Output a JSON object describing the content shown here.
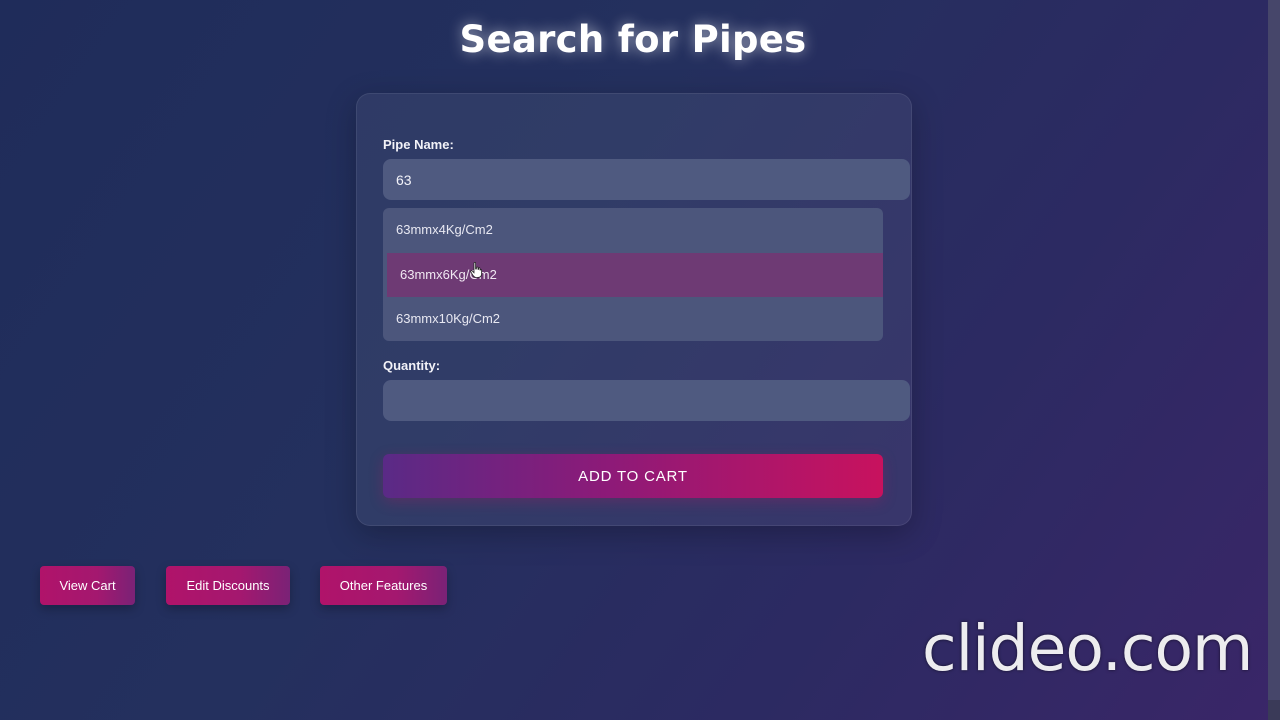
{
  "page": {
    "title": "Search for Pipes"
  },
  "form": {
    "pipe_name_label": "Pipe Name:",
    "pipe_name_value": "63",
    "suggestions": [
      "63mmx4Kg/Cm2",
      "63mmx6Kg/Cm2",
      "63mmx10Kg/Cm2"
    ],
    "highlighted_suggestion_index": 1,
    "quantity_label": "Quantity:",
    "quantity_value": "",
    "add_to_cart_label": "ADD TO CART"
  },
  "nav": {
    "view_cart_label": "View Cart",
    "edit_discounts_label": "Edit Discounts",
    "other_features_label": "Other Features"
  },
  "watermark": {
    "text": "clideo.com"
  },
  "colors": {
    "background": "#24305e",
    "accent": "#c8125e",
    "highlight": "#6e3a74",
    "input_bg": "#4f5a80"
  },
  "icons": {
    "cursor": "hand-pointer-icon"
  }
}
